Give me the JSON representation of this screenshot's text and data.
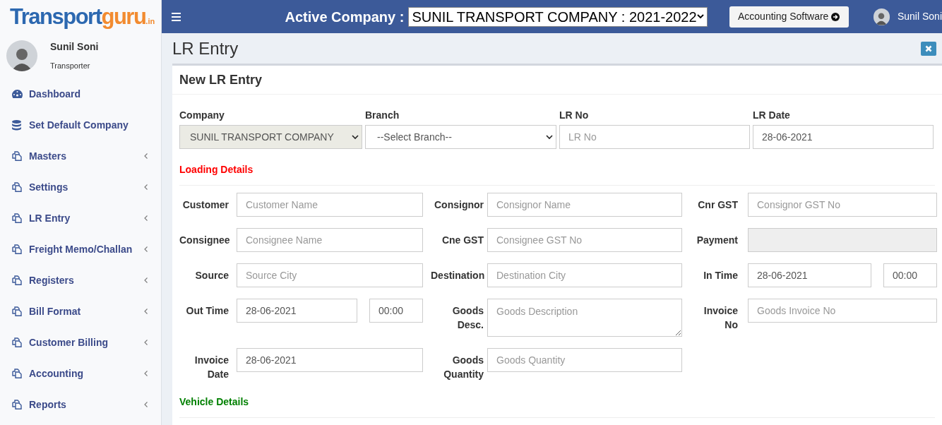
{
  "brand": {
    "logo_main": "Transport",
    "logo_accent": "guru",
    "logo_suffix": ".in"
  },
  "user": {
    "name": "Sunil Soni",
    "role": "Transporter"
  },
  "sidebar": {
    "items": [
      {
        "label": "Dashboard",
        "submenu": false
      },
      {
        "label": "Set Default Company",
        "submenu": false
      },
      {
        "label": "Masters",
        "submenu": true
      },
      {
        "label": "Settings",
        "submenu": true
      },
      {
        "label": "LR Entry",
        "submenu": true
      },
      {
        "label": "Freight Memo/Challan",
        "submenu": true
      },
      {
        "label": "Registers",
        "submenu": true
      },
      {
        "label": "Bill Format",
        "submenu": true
      },
      {
        "label": "Customer Billing",
        "submenu": true
      },
      {
        "label": "Accounting",
        "submenu": true
      },
      {
        "label": "Reports",
        "submenu": true
      }
    ]
  },
  "topbar": {
    "active_company_label": "Active Company :",
    "active_company_value": "SUNIL TRANSPORT COMPANY : 2021-2022",
    "software_button": "Accounting Software",
    "user_name": "Sunil Soni"
  },
  "page_title": "LR Entry",
  "card": {
    "title": "New LR Entry",
    "top_fields": [
      {
        "label": "Company",
        "kind": "select",
        "value": "SUNIL TRANSPORT COMPANY",
        "disabled": true
      },
      {
        "label": "Branch",
        "kind": "select",
        "value": "--Select Branch--",
        "disabled": false
      },
      {
        "label": "LR No",
        "kind": "text",
        "placeholder": "LR No"
      },
      {
        "label": "LR Date",
        "kind": "text",
        "value": "28-06-2021"
      }
    ],
    "sections": [
      {
        "title": "Loading Details",
        "color": "#ff0000",
        "rows": [
          {
            "cells": [
              {
                "label": "Customer",
                "inputs": [
                  {
                    "kind": "text",
                    "placeholder": "Customer Name"
                  }
                ]
              },
              {
                "label": "Consignor",
                "inputs": [
                  {
                    "kind": "text",
                    "placeholder": "Consignor Name"
                  }
                ]
              },
              {
                "label": "Cnr GST",
                "inputs": [
                  {
                    "kind": "text",
                    "placeholder": "Consignor GST No"
                  }
                ]
              }
            ]
          },
          {
            "cells": [
              {
                "label": "Consignee",
                "inputs": [
                  {
                    "kind": "text",
                    "placeholder": "Consignee Name"
                  }
                ]
              },
              {
                "label": "Cne GST",
                "inputs": [
                  {
                    "kind": "text",
                    "placeholder": "Consignee GST No"
                  }
                ]
              },
              {
                "label": "Payment",
                "inputs": [
                  {
                    "kind": "disabled"
                  }
                ]
              }
            ]
          },
          {
            "cells": [
              {
                "label": "Source",
                "inputs": [
                  {
                    "kind": "text",
                    "placeholder": "Source City"
                  }
                ]
              },
              {
                "label": "Destination",
                "inputs": [
                  {
                    "kind": "text",
                    "placeholder": "Destination City"
                  }
                ]
              },
              {
                "label": "In Time",
                "inputs": [
                  {
                    "kind": "text",
                    "value": "28-06-2021"
                  },
                  {
                    "kind": "time",
                    "value": "00:00"
                  }
                ]
              }
            ]
          },
          {
            "cells": [
              {
                "label": "Out Time",
                "inputs": [
                  {
                    "kind": "text",
                    "value": "28-06-2021"
                  },
                  {
                    "kind": "time",
                    "value": "00:00"
                  }
                ]
              },
              {
                "label": "Goods Desc.",
                "inputs": [
                  {
                    "kind": "textarea",
                    "placeholder": "Goods Description"
                  }
                ]
              },
              {
                "label": "Invoice No",
                "inputs": [
                  {
                    "kind": "text",
                    "placeholder": "Goods Invoice No"
                  }
                ]
              }
            ]
          },
          {
            "cells": [
              {
                "label": "Invoice Date",
                "inputs": [
                  {
                    "kind": "text",
                    "value": "28-06-2021"
                  }
                ]
              },
              {
                "label": "Goods Quantity",
                "inputs": [
                  {
                    "kind": "text",
                    "placeholder": "Goods Quantity"
                  }
                ]
              }
            ]
          }
        ]
      },
      {
        "title": "Vehicle Details",
        "color": "#008000"
      }
    ]
  }
}
